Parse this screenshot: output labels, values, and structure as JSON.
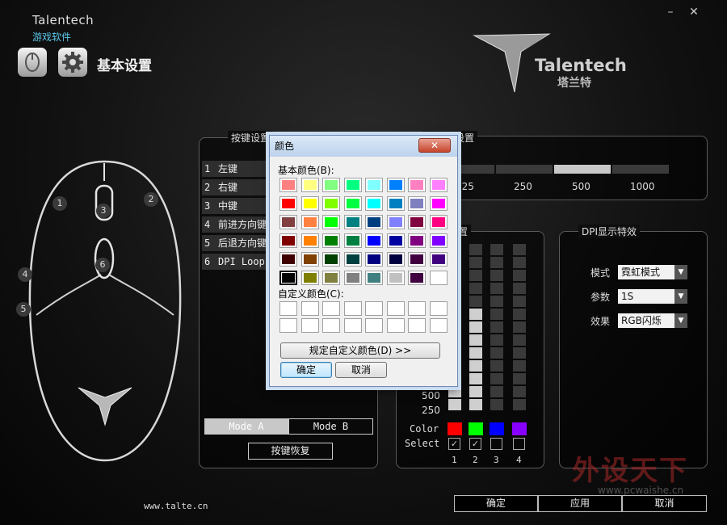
{
  "app": {
    "brand": "Talentech",
    "subtitle": "游戏软件",
    "section_title": "基本设置"
  },
  "window": {
    "minimize": "–",
    "close": "✕"
  },
  "logo": {
    "brand": "Talentech",
    "cn": "塔兰特"
  },
  "mouse_numbers": [
    "1",
    "2",
    "3",
    "4",
    "5",
    "6"
  ],
  "key_settings": {
    "title": "按键设置",
    "rows": [
      {
        "num": "1",
        "label": "左键"
      },
      {
        "num": "2",
        "label": "右键"
      },
      {
        "num": "3",
        "label": "中键"
      },
      {
        "num": "4",
        "label": "前进方向键"
      },
      {
        "num": "5",
        "label": "后退方向键"
      },
      {
        "num": "6",
        "label": "DPI Loop"
      }
    ],
    "mode_a": "Mode A",
    "mode_b": "Mode B",
    "restore": "按键恢复"
  },
  "report_rate": {
    "title_fragment": "回报率设置",
    "labels": [
      "125",
      "250",
      "500",
      "1000"
    ],
    "selected_index": 2
  },
  "dpi": {
    "title_fragment": "置",
    "levels": [
      "500",
      "250"
    ],
    "color_label": "Color",
    "select_label": "Select",
    "columns": [
      "1",
      "2",
      "3",
      "4"
    ],
    "colors": [
      "#ff0000",
      "#00ff00",
      "#0000ff",
      "#8800ff"
    ],
    "checked": [
      true,
      true,
      false,
      false
    ],
    "lit_counts": [
      7,
      8,
      0,
      0
    ]
  },
  "dpi_effect": {
    "title": "DPI显示特效",
    "mode_label": "模式",
    "mode_value": "霓虹模式",
    "param_label": "参数",
    "param_value": "1S",
    "effect_label": "效果",
    "effect_value": "RGB闪烁"
  },
  "footer": {
    "url": "www.talte.cn",
    "ok": "确定",
    "apply": "应用",
    "cancel": "取消"
  },
  "watermark": {
    "cn": "外设天下",
    "url": "www.pcwaishe.cn"
  },
  "color_dialog": {
    "title": "颜色",
    "basic_label": "基本颜色(B):",
    "custom_label": "自定义颜色(C):",
    "define_button": "规定自定义颜色(D) >>",
    "ok": "确定",
    "cancel": "取消",
    "selected_index": 40,
    "basic_colors": [
      "#ff8080",
      "#ffff80",
      "#80ff80",
      "#00ff80",
      "#80ffff",
      "#0080ff",
      "#ff80c0",
      "#ff80ff",
      "#ff0000",
      "#ffff00",
      "#80ff00",
      "#00ff40",
      "#00ffff",
      "#0080c0",
      "#8080c0",
      "#ff00ff",
      "#804040",
      "#ff8040",
      "#00ff00",
      "#008080",
      "#004080",
      "#8080ff",
      "#800040",
      "#ff0080",
      "#800000",
      "#ff8000",
      "#008000",
      "#008040",
      "#0000ff",
      "#0000a0",
      "#800080",
      "#8000ff",
      "#400000",
      "#804000",
      "#004000",
      "#004040",
      "#000080",
      "#000040",
      "#400040",
      "#400080",
      "#000000",
      "#808000",
      "#808040",
      "#808080",
      "#408080",
      "#c0c0c0",
      "#400040",
      "#ffffff"
    ],
    "custom_count": 16
  }
}
